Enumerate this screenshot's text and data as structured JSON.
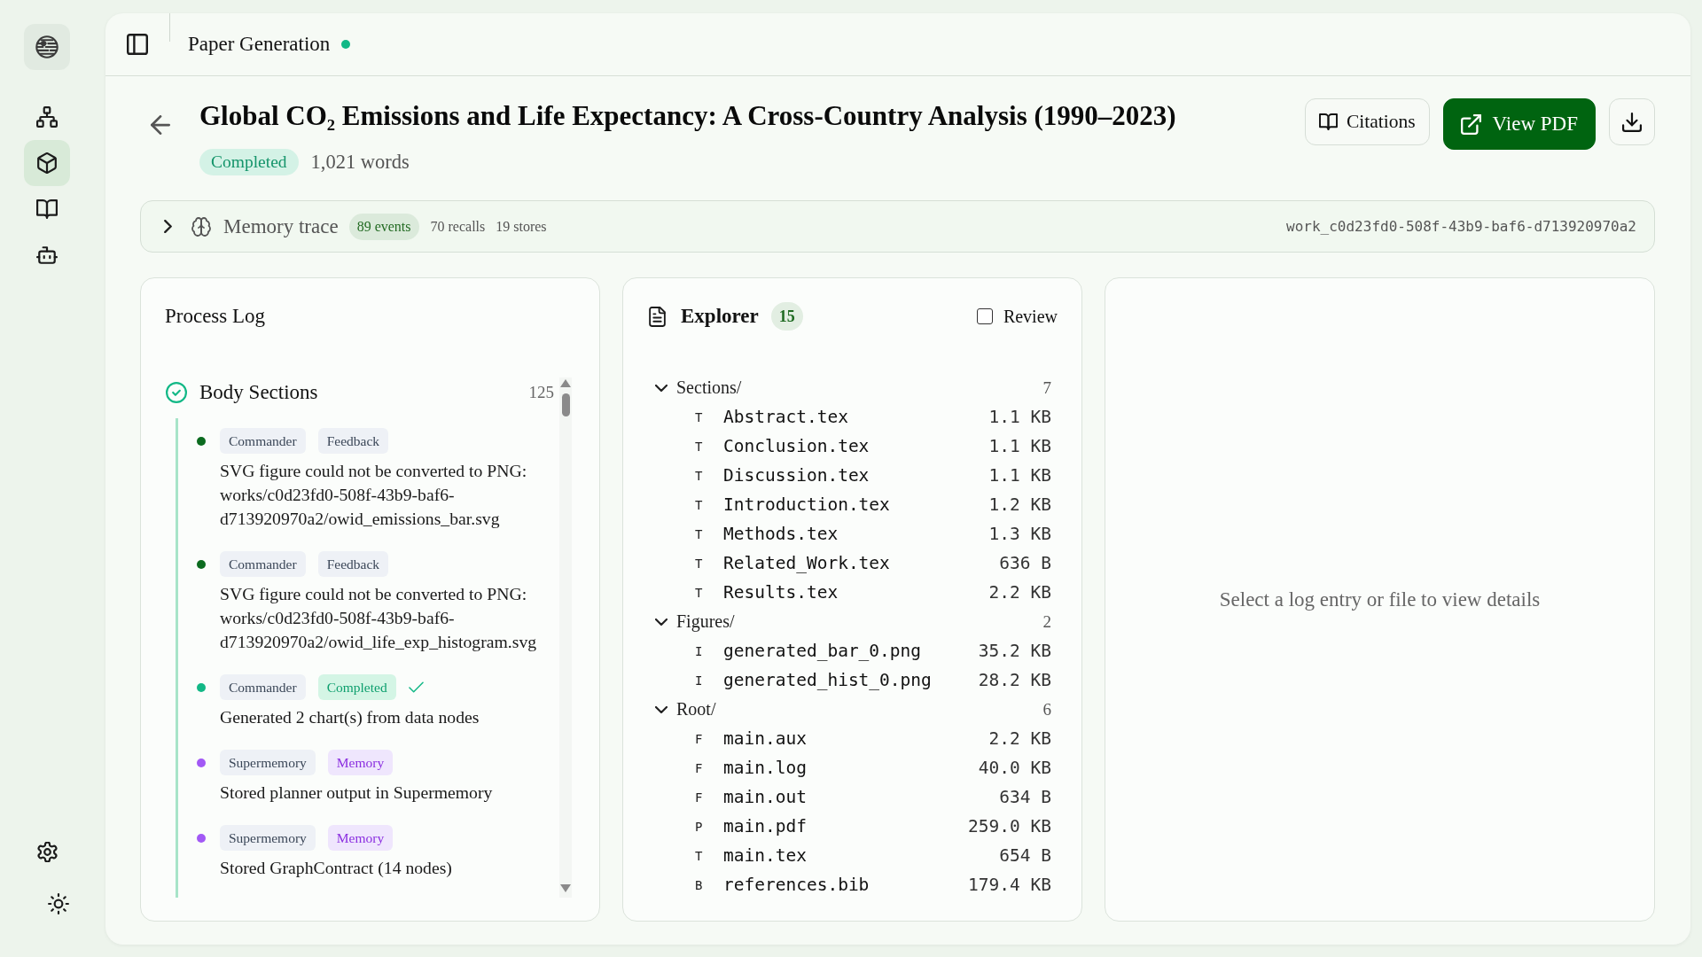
{
  "rail": {
    "items": [
      {
        "selected": false
      },
      {
        "selected": true
      },
      {
        "selected": false
      },
      {
        "selected": false
      }
    ]
  },
  "header": {
    "title": "Paper Generation",
    "live": true
  },
  "paper": {
    "title": "Global CO₂ Emissions and Life Expectancy: A Cross-Country Analysis (1990–2023)",
    "status": "Completed",
    "word_count": "1,021 words",
    "actions": [
      {
        "label": "Citations",
        "kind": "secondary"
      },
      {
        "label": "View PDF",
        "kind": "primary"
      }
    ]
  },
  "memory_trace": {
    "label": "Memory trace",
    "expanded": false,
    "events": "89 events",
    "recalls": "70 recalls",
    "stores": "19 stores",
    "work_id": "work_c0d23fd0-508f-43b9-baf6-d713920970a2"
  },
  "process_log": {
    "title": "Process Log",
    "section": {
      "title": "Body Sections",
      "count": "125",
      "done": true,
      "entries": [
        {
          "color": "#0b6b1f",
          "tags": [
            {
              "label": "Commander",
              "kind": "neutral"
            },
            {
              "label": "Feedback",
              "kind": "neutral"
            }
          ],
          "confirmed": false,
          "text": "SVG figure could not be converted to PNG: works/c0d23fd0-508f-43b9-baf6-d713920970a2/owid_emissions_bar.svg"
        },
        {
          "color": "#0b6b1f",
          "tags": [
            {
              "label": "Commander",
              "kind": "neutral"
            },
            {
              "label": "Feedback",
              "kind": "neutral"
            }
          ],
          "confirmed": false,
          "text": "SVG figure could not be converted to PNG: works/c0d23fd0-508f-43b9-baf6-d713920970a2/owid_life_exp_histogram.svg"
        },
        {
          "color": "#12b886",
          "tags": [
            {
              "label": "Commander",
              "kind": "neutral"
            },
            {
              "label": "Completed",
              "kind": "success"
            }
          ],
          "confirmed": true,
          "text": "Generated 2 chart(s) from data nodes"
        },
        {
          "color": "#a259f5",
          "tags": [
            {
              "label": "Supermemory",
              "kind": "neutral"
            },
            {
              "label": "Memory",
              "kind": "memory"
            }
          ],
          "confirmed": false,
          "text": "Stored planner output in Supermemory"
        },
        {
          "color": "#a259f5",
          "tags": [
            {
              "label": "Supermemory",
              "kind": "neutral"
            },
            {
              "label": "Memory",
              "kind": "memory"
            }
          ],
          "confirmed": false,
          "text": "Stored GraphContract (14 nodes)"
        }
      ]
    }
  },
  "explorer": {
    "title": "Explorer",
    "count": "15",
    "review": {
      "label": "Review",
      "checked": false
    },
    "folders": [
      {
        "name": "Sections/",
        "count": "7",
        "expanded": true,
        "children": [
          {
            "letter": "T",
            "name": "Abstract.tex",
            "size": "1.1 KB"
          },
          {
            "letter": "T",
            "name": "Conclusion.tex",
            "size": "1.1 KB"
          },
          {
            "letter": "T",
            "name": "Discussion.tex",
            "size": "1.1 KB"
          },
          {
            "letter": "T",
            "name": "Introduction.tex",
            "size": "1.2 KB"
          },
          {
            "letter": "T",
            "name": "Methods.tex",
            "size": "1.3 KB"
          },
          {
            "letter": "T",
            "name": "Related_Work.tex",
            "size": "636 B"
          },
          {
            "letter": "T",
            "name": "Results.tex",
            "size": "2.2 KB"
          }
        ]
      },
      {
        "name": "Figures/",
        "count": "2",
        "expanded": true,
        "children": [
          {
            "letter": "I",
            "name": "generated_bar_0.png",
            "size": "35.2 KB"
          },
          {
            "letter": "I",
            "name": "generated_hist_0.png",
            "size": "28.2 KB"
          }
        ]
      },
      {
        "name": "Root/",
        "count": "6",
        "expanded": true,
        "children": [
          {
            "letter": "F",
            "name": "main.aux",
            "size": "2.2 KB"
          },
          {
            "letter": "F",
            "name": "main.log",
            "size": "40.0 KB"
          },
          {
            "letter": "F",
            "name": "main.out",
            "size": "634 B"
          },
          {
            "letter": "P",
            "name": "main.pdf",
            "size": "259.0 KB"
          },
          {
            "letter": "T",
            "name": "main.tex",
            "size": "654 B"
          },
          {
            "letter": "B",
            "name": "references.bib",
            "size": "179.4 KB"
          }
        ]
      }
    ]
  },
  "details": {
    "empty_message": "Select a log entry or file to view details"
  }
}
